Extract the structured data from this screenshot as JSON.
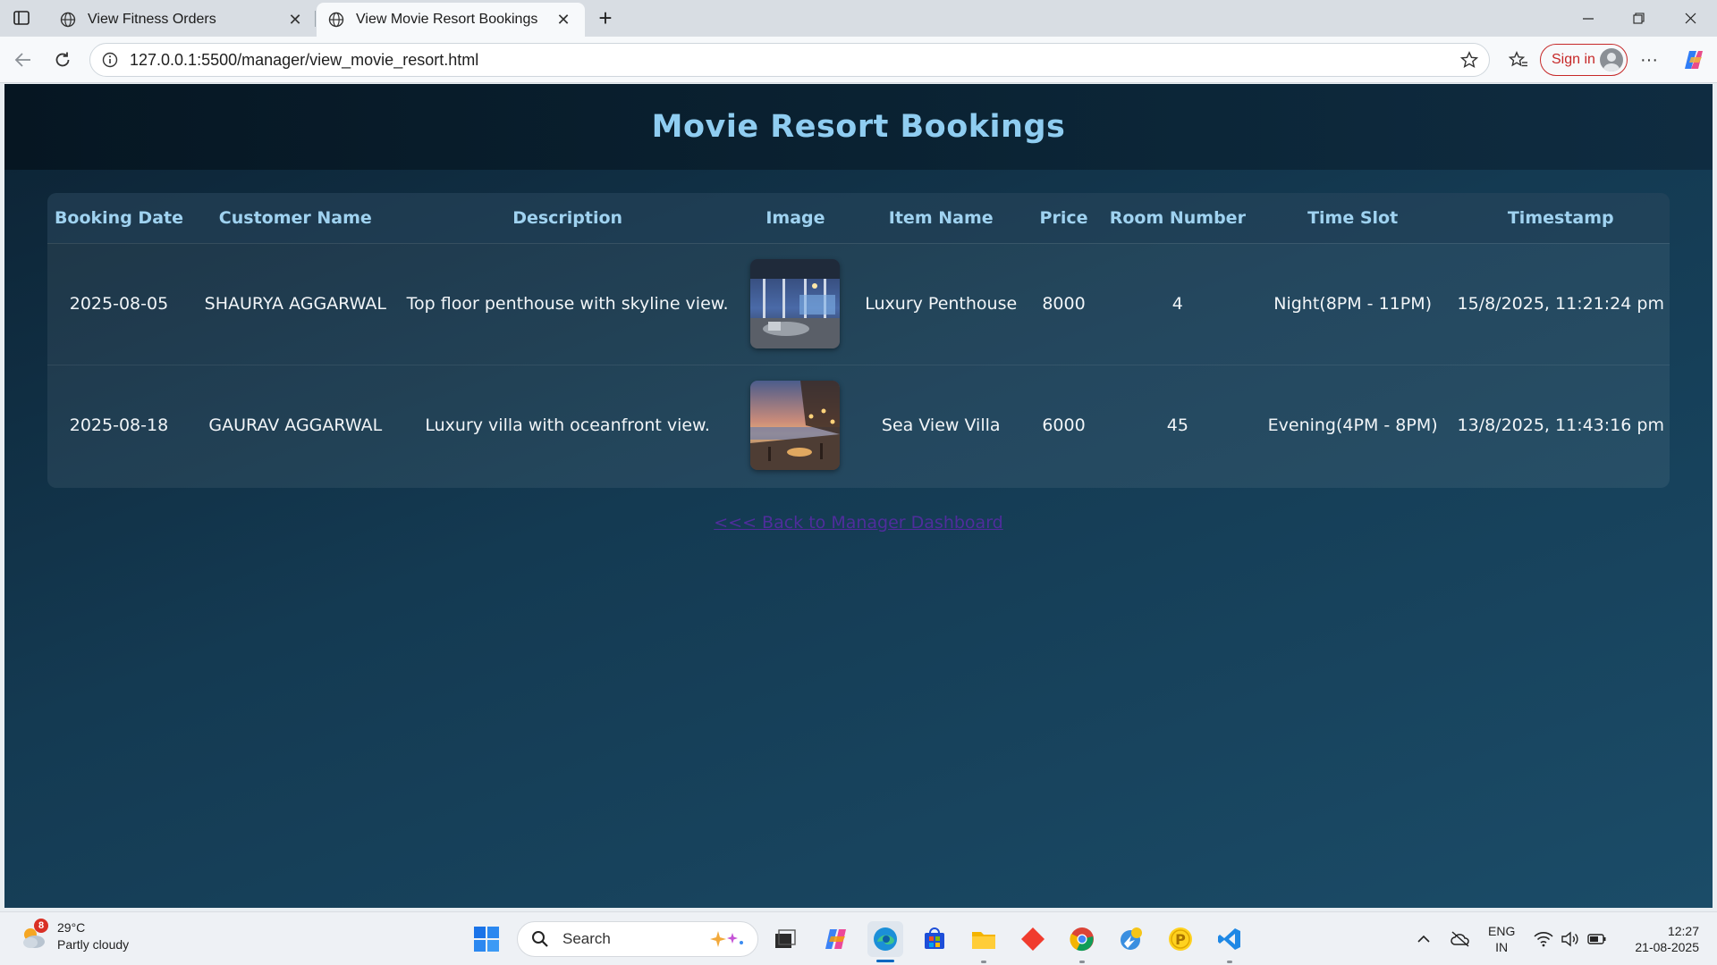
{
  "browser": {
    "tabs": [
      {
        "label": "View Fitness Orders",
        "active": false
      },
      {
        "label": "View Movie Resort Bookings",
        "active": true
      }
    ],
    "url": "127.0.0.1:5500/manager/view_movie_resort.html",
    "signin_label": "Sign in"
  },
  "page": {
    "title": "Movie Resort Bookings",
    "columns": [
      "Booking Date",
      "Customer Name",
      "Description",
      "Image",
      "Item Name",
      "Price",
      "Room Number",
      "Time Slot",
      "Timestamp"
    ],
    "rows": [
      {
        "booking_date": "2025-08-05",
        "customer_name": "SHAURYA AGGARWAL",
        "description": "Top floor penthouse with skyline view.",
        "image": "luxury-penthouse-photo",
        "item_name": "Luxury Penthouse",
        "price": "8000",
        "room_number": "4",
        "time_slot": "Night(8PM - 11PM)",
        "timestamp": "15/8/2025, 11:21:24 pm"
      },
      {
        "booking_date": "2025-08-18",
        "customer_name": "GAURAV AGGARWAL",
        "description": "Luxury villa with oceanfront view.",
        "image": "sea-view-villa-photo",
        "item_name": "Sea View Villa",
        "price": "6000",
        "room_number": "45",
        "time_slot": "Evening(4PM - 8PM)",
        "timestamp": "13/8/2025, 11:43:16 pm"
      }
    ],
    "back_link": "<<< Back to Manager Dashboard"
  },
  "taskbar": {
    "weather_temp": "29°C",
    "weather_desc": "Partly cloudy",
    "weather_badge": "8",
    "search_placeholder": "Search",
    "lang_line1": "ENG",
    "lang_line2": "IN",
    "time": "12:27",
    "date": "21-08-2025"
  },
  "colors": {
    "title": "#8fcdf1",
    "header_text": "#9fd2f0",
    "page_bg_start": "#0c2233",
    "page_bg_end": "#1b4c68",
    "link": "#4f2d9c",
    "signin": "#c62828"
  }
}
